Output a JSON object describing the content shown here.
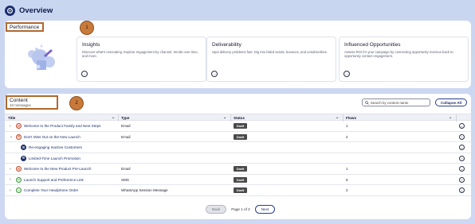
{
  "header": {
    "title": "Overview"
  },
  "performance": {
    "label": "Performance",
    "badge": "1",
    "cards": [
      {
        "title": "Insights",
        "description": "Discover what's resonating. Explore engagement by channel, trends over time, and more."
      },
      {
        "title": "Deliverability",
        "description": "Spot delivery problems fast. Dig into failed sends, bounces, and unsubscribes."
      },
      {
        "title": "Influenced Opportunities",
        "description": "Assess ROI for your campaign by connecting opportunity revenue back to opportunity contact engagement."
      }
    ]
  },
  "content": {
    "label": "Content",
    "count": "10 messages",
    "badge": "2",
    "search_placeholder": "Search by content name",
    "collapse_label": "Collapse All",
    "columns": {
      "title": "Title",
      "type": "Type",
      "status": "Status",
      "flows": "Flows"
    },
    "rows": [
      {
        "expander": "›",
        "icon": "email",
        "title": "Welcome to the Product Family and Next Steps",
        "type": "Email",
        "status": "Draft",
        "flows": "1"
      },
      {
        "expander": "⌄",
        "icon": "email",
        "title": "Don't Miss Out on the New Launch",
        "type": "Email",
        "status": "Draft",
        "flows": "2"
      },
      {
        "expander": "",
        "icon": "flow",
        "title": "Re-engaging Inactive Customers",
        "type": "",
        "status": "",
        "flows": "",
        "child": true
      },
      {
        "expander": "",
        "icon": "flow",
        "title": "Limited-Time Launch Promotion",
        "type": "",
        "status": "",
        "flows": "",
        "child": true
      },
      {
        "expander": "›",
        "icon": "email",
        "title": "Welcome to the New Product Pre-Launch",
        "type": "Email",
        "status": "Draft",
        "flows": "1"
      },
      {
        "expander": "›",
        "icon": "sms",
        "title": "Launch Support and Preference Link",
        "type": "SMS",
        "status": "Draft",
        "flows": "6"
      },
      {
        "expander": "›",
        "icon": "wa",
        "title": "Complete Your Headphone Order",
        "type": "WhatsApp Session Message",
        "status": "Draft",
        "flows": "2"
      }
    ],
    "pagination": {
      "back": "Back",
      "page_text": "Page 1 of 2",
      "next": "Next"
    }
  },
  "colors": {
    "accent": "#1b2e6e",
    "badge": "#c97a3a",
    "draft": "#4a4a4a"
  }
}
